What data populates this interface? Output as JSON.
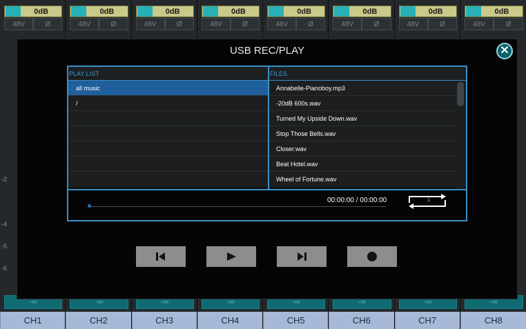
{
  "channels": [
    {
      "name": "CH1",
      "gain": "0dB",
      "phantom": "48V",
      "phase": "Ø",
      "level": "-∞"
    },
    {
      "name": "CH2",
      "gain": "0dB",
      "phantom": "48V",
      "phase": "Ø",
      "level": "-∞"
    },
    {
      "name": "CH3",
      "gain": "0dB",
      "phantom": "48V",
      "phase": "Ø",
      "level": "-∞"
    },
    {
      "name": "CH4",
      "gain": "0dB",
      "phantom": "48V",
      "phase": "Ø",
      "level": "-∞"
    },
    {
      "name": "CH5",
      "gain": "0dB",
      "phantom": "48V",
      "phase": "Ø",
      "level": "-∞"
    },
    {
      "name": "CH6",
      "gain": "0dB",
      "phantom": "48V",
      "phase": "Ø",
      "level": "-∞"
    },
    {
      "name": "CH7",
      "gain": "0dB",
      "phantom": "48V",
      "phase": "Ø",
      "level": "-∞"
    },
    {
      "name": "CH8",
      "gain": "0dB",
      "phantom": "48V",
      "phase": "Ø",
      "level": "-∞"
    }
  ],
  "scale_marks": [
    "-2",
    "-4",
    "-5",
    "-6"
  ],
  "dialog": {
    "title": "USB REC/PLAY",
    "close_icon": "close-icon",
    "playlist_header": "PLAY LIST",
    "files_header": "FILES",
    "playlist": [
      "all music",
      "/",
      "",
      "",
      "",
      "",
      ""
    ],
    "playlist_selected": 0,
    "files": [
      "Annabelle-Pianoboy.mp3",
      "-20dB 600s.wav",
      "Turned My Upside Down.wav",
      "Stop Those Bells.wav",
      "Closer.wav",
      "Beat Hotel.wav",
      "Wheel of Fortune.wav"
    ],
    "time": "00:00:00 / 00:00:00",
    "loop_count": "1",
    "progress": 0,
    "transport": [
      "previous-icon",
      "play-icon",
      "next-icon",
      "record-icon"
    ]
  },
  "colors": {
    "accent_blue": "#3b8fc7",
    "selected_row": "#1f5f9c",
    "teal": "#0f6a72"
  }
}
